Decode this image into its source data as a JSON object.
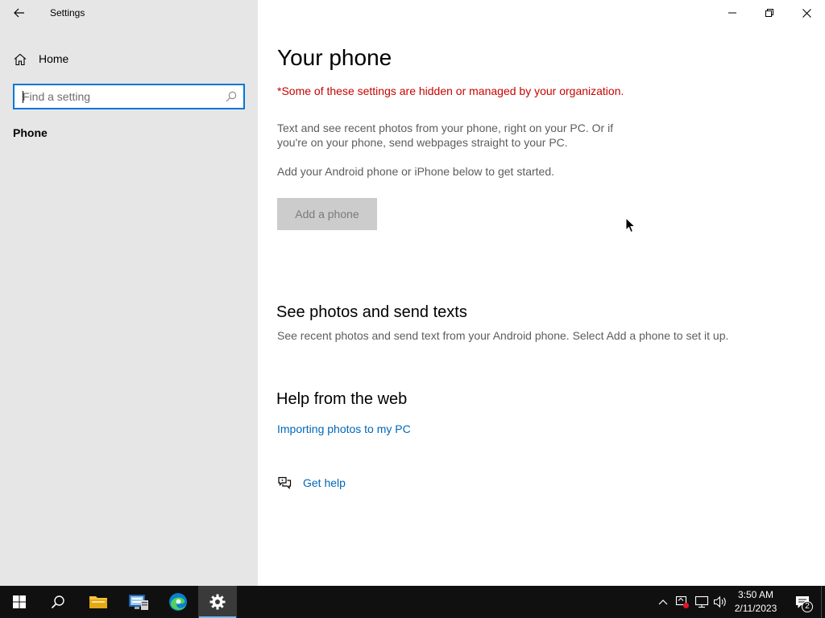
{
  "window": {
    "title": "Settings"
  },
  "sidebar": {
    "home_label": "Home",
    "search_placeholder": "Find a setting",
    "nav_items": [
      {
        "label": "Phone"
      }
    ]
  },
  "main": {
    "title": "Your phone",
    "org_notice": "*Some of these settings are hidden or managed by your organization.",
    "description": "Text and see recent photos from your phone, right on your PC. Or if you're on your phone, send webpages straight to your PC.",
    "description2": "Add your Android phone or iPhone below to get started.",
    "add_phone_label": "Add a phone",
    "section1": {
      "title": "See photos and send texts",
      "description": "See recent photos and send text from your Android phone. Select Add a phone to set it up."
    },
    "section2": {
      "title": "Help from the web",
      "link": "Importing photos to my PC"
    },
    "get_help_label": "Get help"
  },
  "taskbar": {
    "time": "3:50 AM",
    "date": "2/11/2023",
    "notification_count": "2"
  },
  "colors": {
    "accent": "#0078d7",
    "link": "#0067b8",
    "warning": "#c50500",
    "sidebar_bg": "#e6e6e6",
    "taskbar_bg": "#101010",
    "active_underline": "#76b9ed"
  }
}
